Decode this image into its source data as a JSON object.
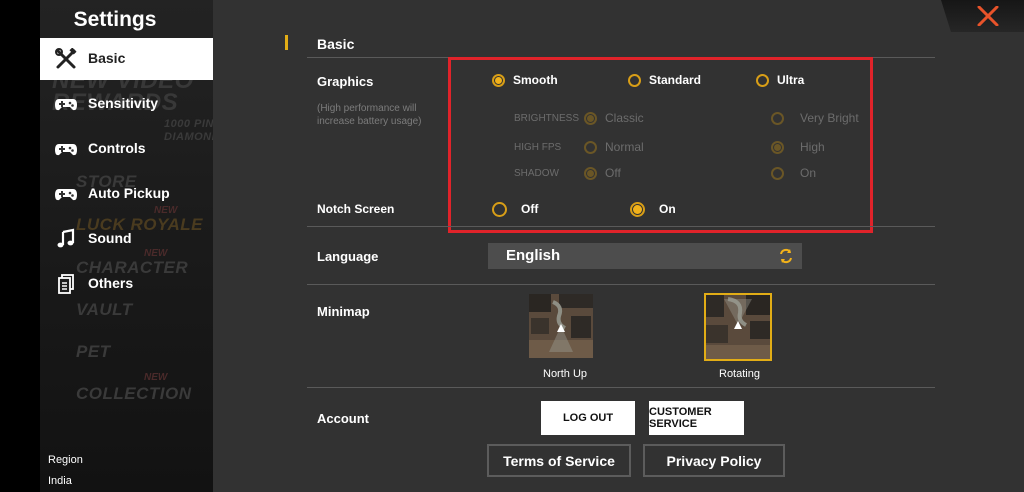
{
  "sidebar": {
    "title": "Settings",
    "items": [
      {
        "label": "Basic",
        "icon": "tools-icon",
        "active": true
      },
      {
        "label": "Sensitivity",
        "icon": "gamepad-icon"
      },
      {
        "label": "Controls",
        "icon": "gamepad-icon"
      },
      {
        "label": "Auto Pickup",
        "icon": "gamepad-icon"
      },
      {
        "label": "Sound",
        "icon": "music-note-icon"
      },
      {
        "label": "Others",
        "icon": "document-icon"
      }
    ],
    "background_menu": {
      "new_video": "NEW VIDEO",
      "rewards": "REWARDS",
      "pin_1": "1000 PIN",
      "pin_2": "DIAMOND",
      "store": "STORE",
      "luck_royale": "LUCK ROYALE",
      "character": "CHARACTER",
      "vault": "VAULT",
      "pet": "PET",
      "collection": "COLLECTION",
      "new_badge": "NEW"
    },
    "region_label": "Region",
    "region_value": "India"
  },
  "section": {
    "title": "Basic"
  },
  "graphics": {
    "label": "Graphics",
    "note": "(High performance will increase battery usage)",
    "options": [
      "Smooth",
      "Standard",
      "Ultra"
    ],
    "selected": "Smooth",
    "brightness": {
      "label": "BRIGHTNESS",
      "options": [
        "Classic",
        "Very Bright"
      ],
      "selected": "Classic"
    },
    "high_fps": {
      "label": "HIGH FPS",
      "options": [
        "Normal",
        "High"
      ],
      "selected": "High"
    },
    "shadow": {
      "label": "SHADOW",
      "options": [
        "Off",
        "On"
      ],
      "selected": "Off"
    }
  },
  "notch_screen": {
    "label": "Notch Screen",
    "options": [
      "Off",
      "On"
    ],
    "selected": "On"
  },
  "language": {
    "label": "Language",
    "value": "English"
  },
  "minimap": {
    "label": "Minimap",
    "options": [
      "North Up",
      "Rotating"
    ],
    "selected": "Rotating"
  },
  "account": {
    "label": "Account",
    "logout": "LOG OUT",
    "customer_service": "CUSTOMER SERVICE"
  },
  "footer": {
    "terms": "Terms of Service",
    "privacy": "Privacy Policy"
  },
  "colors": {
    "accent": "#f2b21a",
    "highlight_box": "#e0232a",
    "panel": "#323232",
    "close": "#e8532a"
  }
}
